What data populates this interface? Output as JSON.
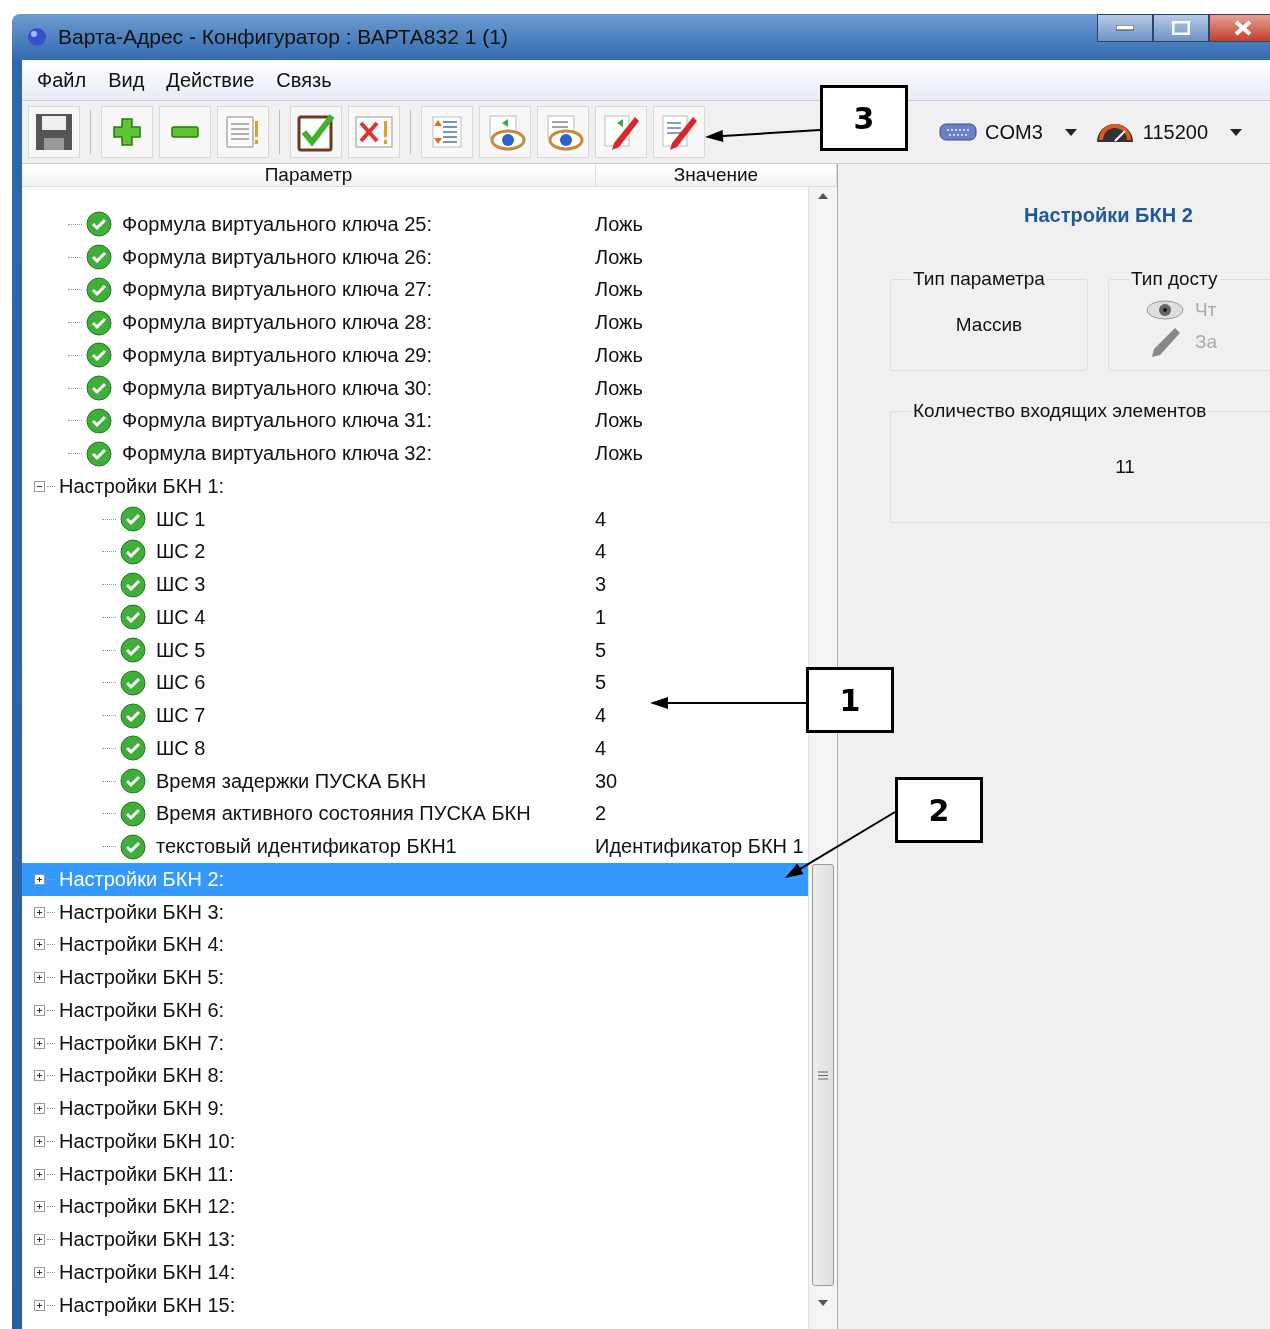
{
  "window": {
    "title": "Варта-Адрес - Конфигуратор : ВАРТА832 1 (1)"
  },
  "menu": [
    "Файл",
    "Вид",
    "Действие",
    "Связь"
  ],
  "toolbar": {
    "buttons": [
      {
        "kind": "save"
      },
      {
        "kind": "add"
      },
      {
        "kind": "remove"
      },
      {
        "kind": "list-warning"
      },
      {
        "kind": "check"
      },
      {
        "kind": "delete-warning"
      },
      {
        "kind": "tree"
      },
      {
        "kind": "view-arrow"
      },
      {
        "kind": "view"
      },
      {
        "kind": "write-arrow"
      },
      {
        "kind": "write"
      }
    ],
    "port": {
      "value": "COM3"
    },
    "baud": {
      "value": "115200"
    }
  },
  "tree": {
    "columns": [
      "Параметр",
      "Значение"
    ],
    "items": [
      {
        "kind": "param",
        "label": "Формула виртуального ключа 25:",
        "value": "Ложь",
        "selected": false
      },
      {
        "kind": "param",
        "label": "Формула виртуального ключа 26:",
        "value": "Ложь",
        "selected": false
      },
      {
        "kind": "param",
        "label": "Формула виртуального ключа 27:",
        "value": "Ложь",
        "selected": false
      },
      {
        "kind": "param",
        "label": "Формула виртуального ключа 28:",
        "value": "Ложь",
        "selected": false
      },
      {
        "kind": "param",
        "label": "Формула виртуального ключа 29:",
        "value": "Ложь",
        "selected": false
      },
      {
        "kind": "param",
        "label": "Формула виртуального ключа 30:",
        "value": "Ложь",
        "selected": false
      },
      {
        "kind": "param",
        "label": "Формула виртуального ключа 31:",
        "value": "Ложь",
        "selected": false
      },
      {
        "kind": "param",
        "label": "Формула виртуального ключа 32:",
        "value": "Ложь",
        "selected": false
      },
      {
        "kind": "group",
        "label": "Настройки БКН 1:",
        "expanded": true,
        "selected": false,
        "children": [
          {
            "kind": "param",
            "label": "ШС 1",
            "value": "4",
            "selected": false
          },
          {
            "kind": "param",
            "label": "ШС 2",
            "value": "4",
            "selected": false
          },
          {
            "kind": "param",
            "label": "ШС 3",
            "value": "3",
            "selected": false
          },
          {
            "kind": "param",
            "label": "ШС 4",
            "value": "1",
            "selected": false
          },
          {
            "kind": "param",
            "label": "ШС 5",
            "value": "5",
            "selected": false
          },
          {
            "kind": "param",
            "label": "ШС 6",
            "value": "5",
            "selected": false
          },
          {
            "kind": "param",
            "label": "ШС 7",
            "value": "4",
            "selected": false
          },
          {
            "kind": "param",
            "label": "ШС 8",
            "value": "4",
            "selected": false
          },
          {
            "kind": "param",
            "label": "Время задержки ПУСКА БКН",
            "value": "30",
            "selected": false
          },
          {
            "kind": "param",
            "label": "Время активного состояния ПУСКА БКН",
            "value": "2",
            "selected": false
          },
          {
            "kind": "param",
            "label": "текстовый идентификатор БКН1",
            "value": "Идентификатор БКН 1",
            "selected": false
          }
        ]
      },
      {
        "kind": "group",
        "label": "Настройки БКН 2:",
        "expanded": false,
        "selected": true
      },
      {
        "kind": "group",
        "label": "Настройки БКН 3:",
        "expanded": false,
        "selected": false
      },
      {
        "kind": "group",
        "label": "Настройки БКН 4:",
        "expanded": false,
        "selected": false
      },
      {
        "kind": "group",
        "label": "Настройки БКН 5:",
        "expanded": false,
        "selected": false
      },
      {
        "kind": "group",
        "label": "Настройки БКН 6:",
        "expanded": false,
        "selected": false
      },
      {
        "kind": "group",
        "label": "Настройки БКН 7:",
        "expanded": false,
        "selected": false
      },
      {
        "kind": "group",
        "label": "Настройки БКН 8:",
        "expanded": false,
        "selected": false
      },
      {
        "kind": "group",
        "label": "Настройки БКН 9:",
        "expanded": false,
        "selected": false
      },
      {
        "kind": "group",
        "label": "Настройки БКН 10:",
        "expanded": false,
        "selected": false
      },
      {
        "kind": "group",
        "label": "Настройки БКН 11:",
        "expanded": false,
        "selected": false
      },
      {
        "kind": "group",
        "label": "Настройки БКН 12:",
        "expanded": false,
        "selected": false
      },
      {
        "kind": "group",
        "label": "Настройки БКН 13:",
        "expanded": false,
        "selected": false
      },
      {
        "kind": "group",
        "label": "Настройки БКН 14:",
        "expanded": false,
        "selected": false
      },
      {
        "kind": "group",
        "label": "Настройки БКН 15:",
        "expanded": false,
        "selected": false
      }
    ]
  },
  "details": {
    "title": "Настройки БКН 2",
    "param_type": {
      "legend": "Тип параметра",
      "value": "Массив"
    },
    "access_type": {
      "legend": "Тип досту",
      "options": [
        {
          "kind": "read",
          "label": "Чт",
          "disabled": true
        },
        {
          "kind": "write",
          "label": "За",
          "disabled": true
        }
      ]
    },
    "count": {
      "legend": "Количество входящих элементов",
      "value": "11"
    }
  },
  "callouts": [
    {
      "label": "3"
    },
    {
      "label": "1"
    },
    {
      "label": "2"
    }
  ]
}
